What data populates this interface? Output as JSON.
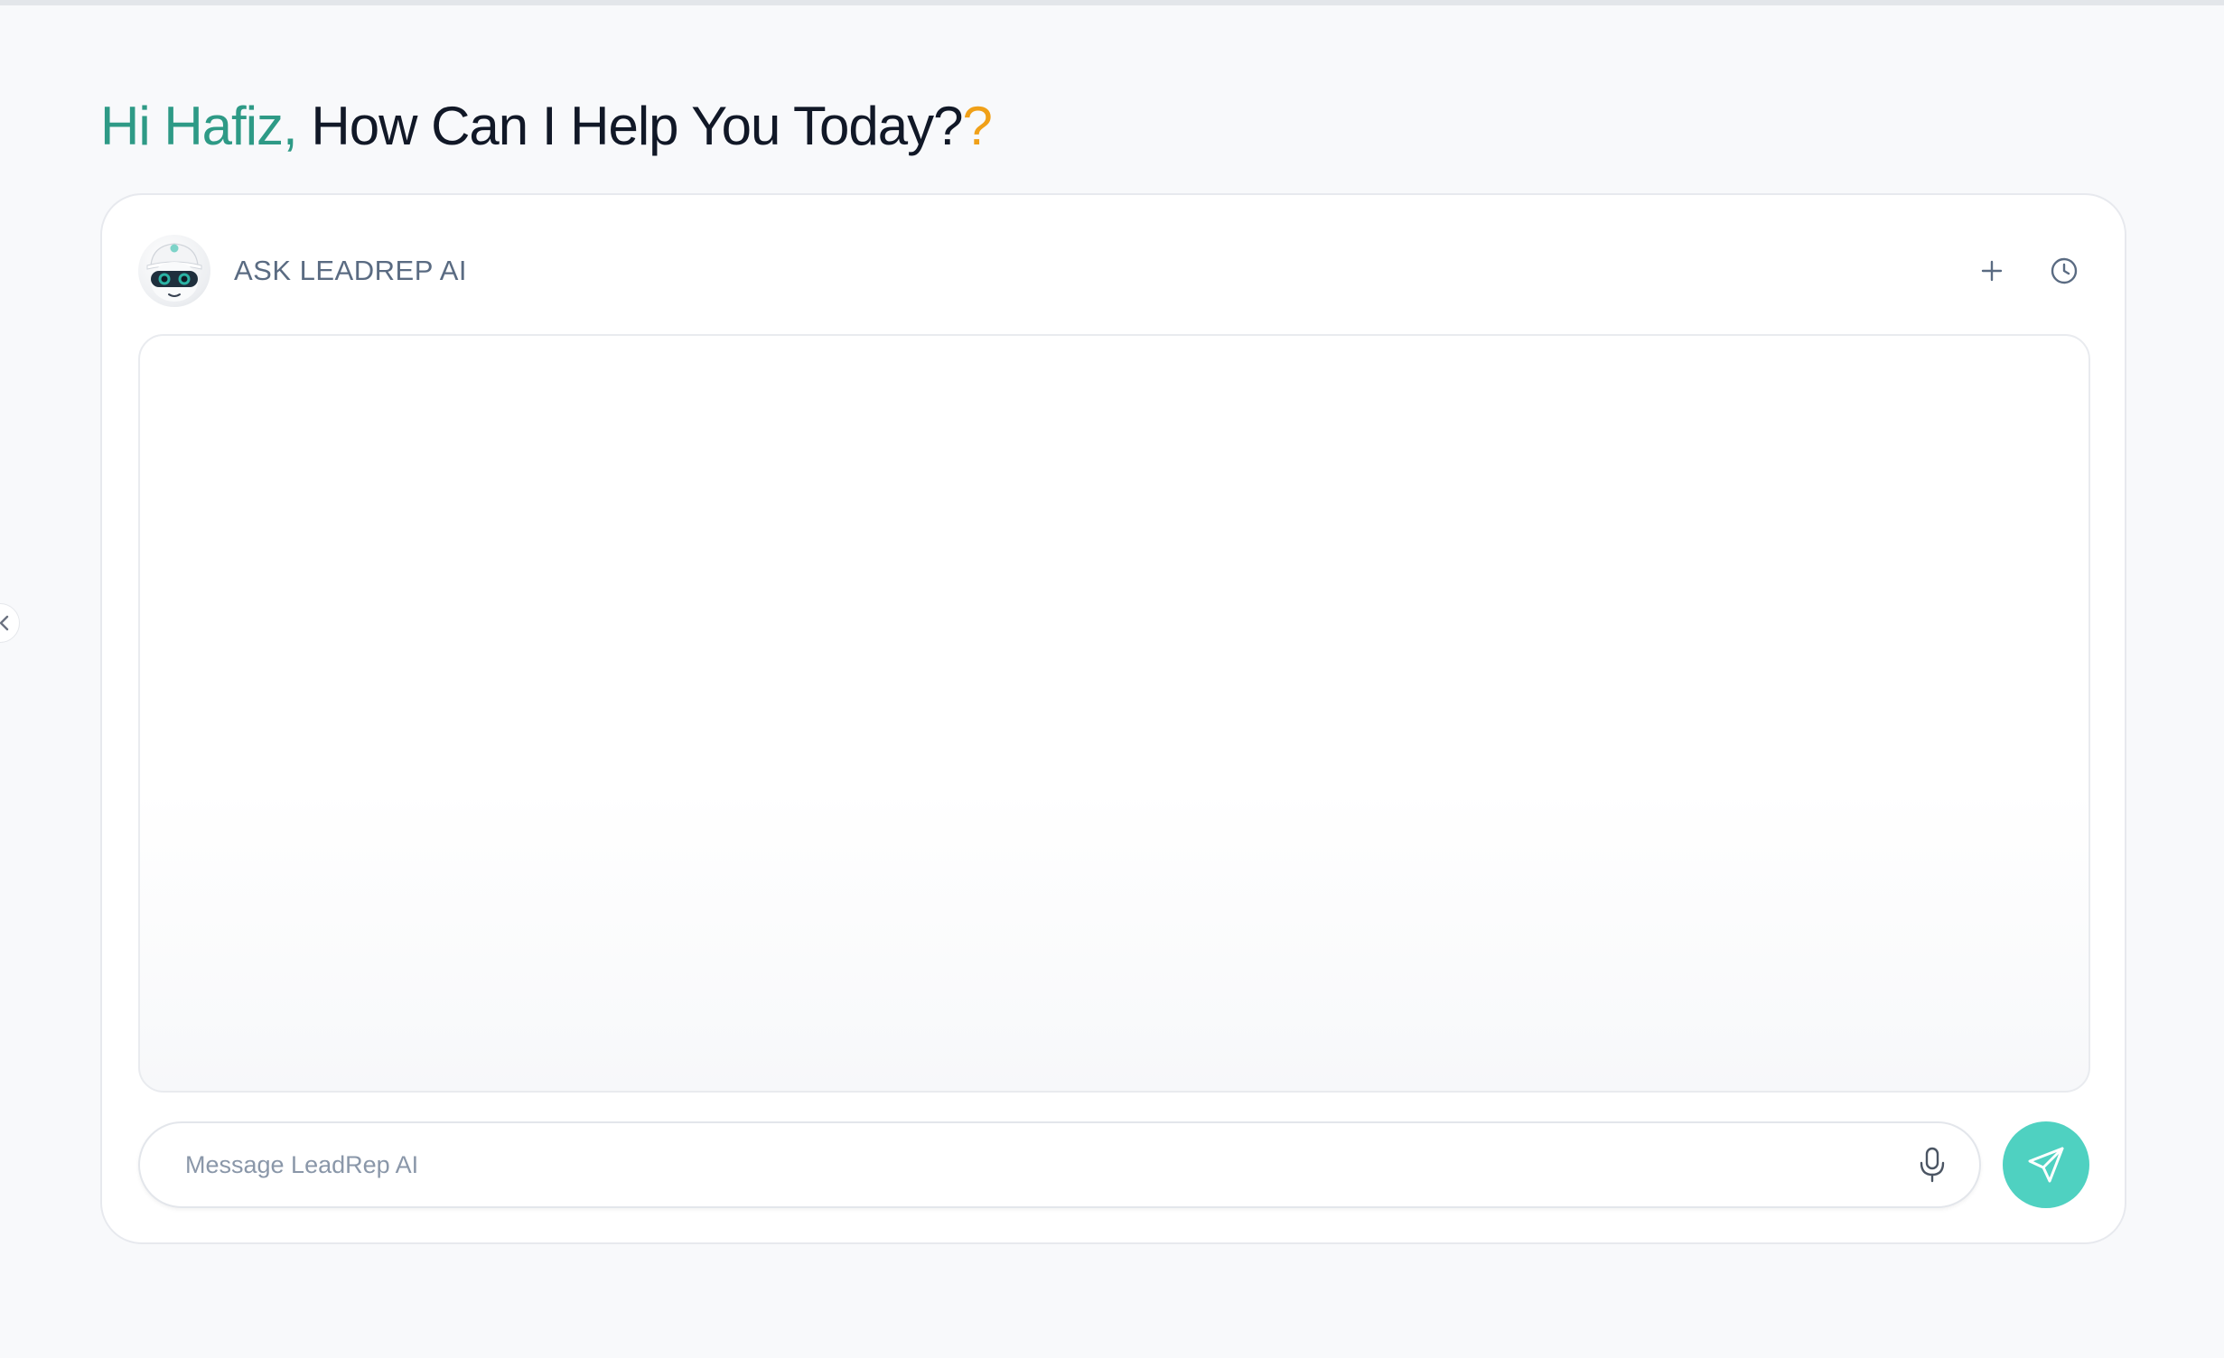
{
  "greeting": {
    "name_part": "Hi Hafiz,",
    "question": "How Can I Help You Today?",
    "accent_mark": "?"
  },
  "chat": {
    "title": "ASK LEADREP AI",
    "avatar_label": "LeadRep",
    "new_chat_icon": "plus-icon",
    "history_icon": "clock-icon",
    "messages": []
  },
  "composer": {
    "placeholder": "Message LeadRep AI",
    "value": "",
    "mic_icon": "microphone-icon",
    "send_icon": "send-icon"
  },
  "colors": {
    "accent_teal": "#2e9a86",
    "send_button": "#4fd1c1",
    "question_mark": "#f0a018",
    "background": "#f8f9fb"
  }
}
